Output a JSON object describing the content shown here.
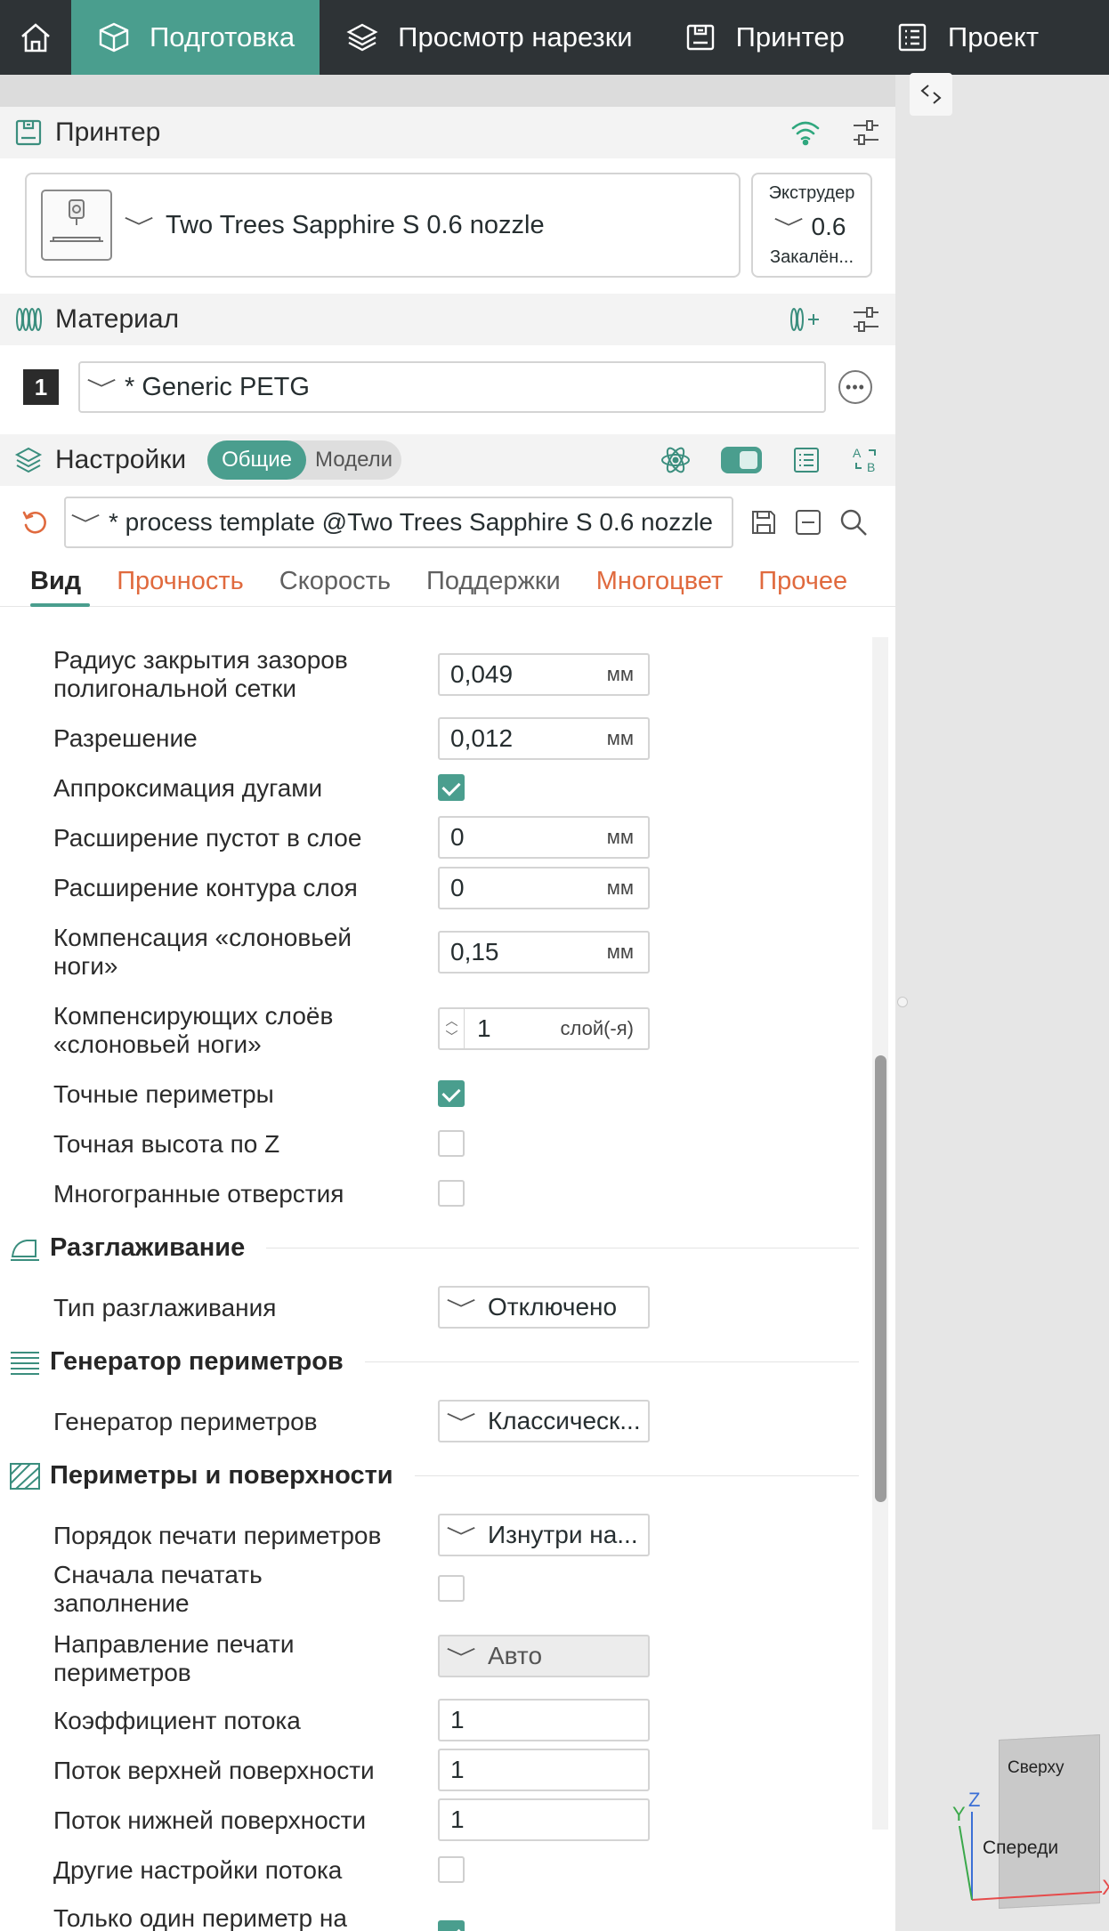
{
  "topbar": {
    "tabs": [
      {
        "label": "Подготовка",
        "active": true
      },
      {
        "label": "Просмотр нарезки"
      },
      {
        "label": "Принтер"
      },
      {
        "label": "Проект"
      }
    ]
  },
  "printer": {
    "section_title": "Принтер",
    "name": "Two Trees Sapphire S 0.6 nozzle",
    "extruder_label": "Экструдер",
    "extruder_value": "0.6",
    "extruder_sub": "Закалён..."
  },
  "material": {
    "section_title": "Материал",
    "slot": "1",
    "value": "* Generic PETG"
  },
  "settings": {
    "section_title": "Настройки",
    "toggle_on": "Общие",
    "toggle_off": "Модели",
    "process": "* process template @Two Trees Sapphire S 0.6 nozzle",
    "tabs": [
      "Вид",
      "Прочность",
      "Скорость",
      "Поддержки",
      "Многоцвет",
      "Прочее"
    ]
  },
  "fields": {
    "slice_closing_radius": {
      "label_1": "Радиус закрытия зазоров",
      "label_2": "полигональной сетки",
      "value": "0,049",
      "unit": "мм"
    },
    "resolution": {
      "label": "Разрешение",
      "value": "0,012",
      "unit": "мм"
    },
    "arc_fitting": {
      "label": "Аппроксимация дугами",
      "checked": true
    },
    "hole_xy_comp": {
      "label": "Расширение пустот в слое",
      "value": "0",
      "unit": "мм"
    },
    "contour_xy_comp": {
      "label": "Расширение контура слоя",
      "value": "0",
      "unit": "мм"
    },
    "elefant_foot": {
      "label_1": "Компенсация «слоновьей",
      "label_2": "ноги»",
      "value": "0,15",
      "unit": "мм"
    },
    "elefant_layers": {
      "label_1": "Компенсирующих слоёв",
      "label_2": "«слоновьей ноги»",
      "value": "1",
      "unit": "слой(-я)"
    },
    "precise_wall": {
      "label": "Точные периметры",
      "checked": true
    },
    "precise_z": {
      "label": "Точная высота по Z",
      "checked": false
    },
    "polyholes": {
      "label": "Многогранные отверстия",
      "checked": false
    },
    "ironing_group": "Разглаживание",
    "ironing_type": {
      "label": "Тип разглаживания",
      "value": "Отключено"
    },
    "wall_gen_group": "Генератор периметров",
    "wall_gen": {
      "label": "Генератор периметров",
      "value": "Классическ..."
    },
    "walls_group": "Периметры и поверхности",
    "wall_order": {
      "label": "Порядок печати периметров",
      "value": "Изнутри на..."
    },
    "infill_first": {
      "label_1": "Сначала печатать",
      "label_2": "заполнение",
      "checked": false
    },
    "wall_direction": {
      "label_1": "Направление печати",
      "label_2": "периметров",
      "value": "Авто"
    },
    "flow_ratio": {
      "label": "Коэффициент потока",
      "value": "1"
    },
    "top_flow": {
      "label": "Поток верхней поверхности",
      "value": "1"
    },
    "bottom_flow": {
      "label": "Поток нижней поверхности",
      "value": "1"
    },
    "other_flow": {
      "label": "Другие настройки потока",
      "checked": false
    },
    "single_perimeter": {
      "label": "Только один периметр на",
      "checked": true
    }
  },
  "view_cube": {
    "top": "Сверху",
    "front": "Спереди",
    "axis_x": "X",
    "axis_y": "Y",
    "axis_z": "Z"
  },
  "colors": {
    "accent": "#4a9e8e",
    "orange": "#e06a3e",
    "topbar": "#2e3336"
  }
}
